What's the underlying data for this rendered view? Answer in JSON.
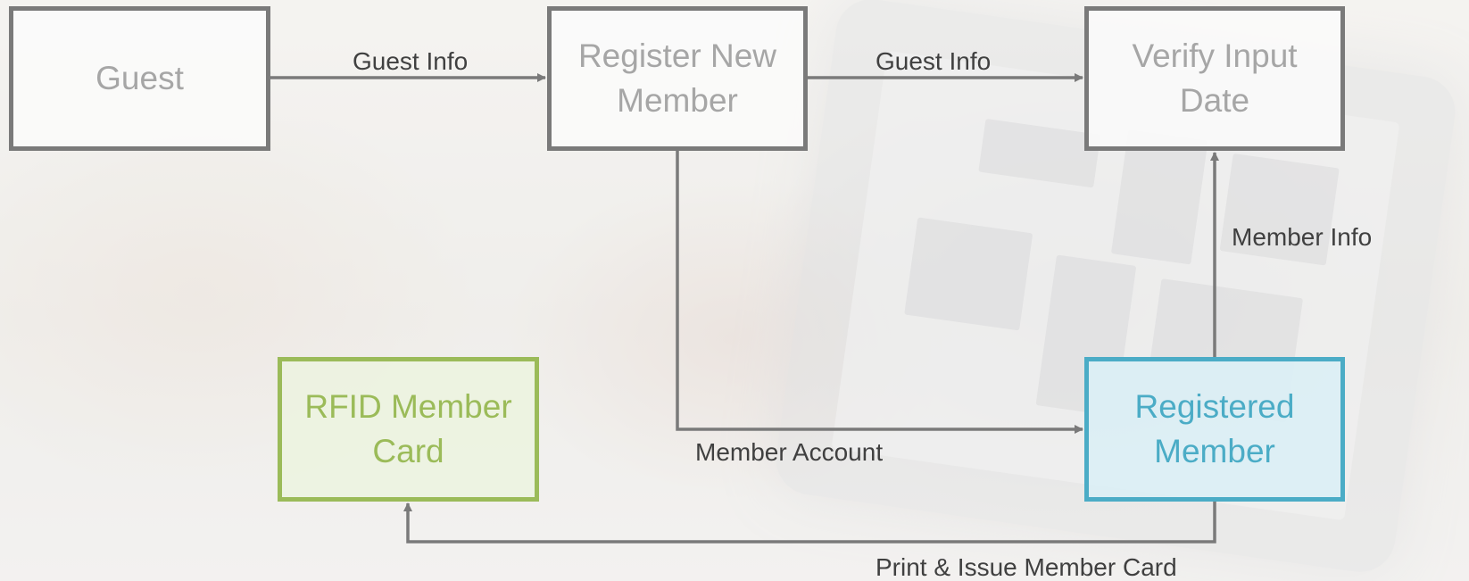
{
  "nodes": {
    "guest": {
      "lines": [
        "Guest"
      ]
    },
    "register_new_member": {
      "lines": [
        "Register New",
        "Member"
      ]
    },
    "verify_input_date": {
      "lines": [
        "Verify Input",
        "Date"
      ]
    },
    "rfid_member_card": {
      "lines": [
        "RFID Member",
        "Card"
      ],
      "color": "#9bbb59"
    },
    "registered_member": {
      "lines": [
        "Registered",
        "Member"
      ],
      "color": "#4bacc6"
    }
  },
  "edges": {
    "guest_to_register": {
      "label": "Guest Info"
    },
    "register_to_verify": {
      "label": "Guest Info"
    },
    "registered_to_verify": {
      "label": "Member Info"
    },
    "register_to_registered": {
      "label": "Member Account"
    },
    "registered_to_rfid": {
      "label": "Print & Issue Member Card"
    }
  },
  "colors": {
    "box_border": "#7a7a7a",
    "connector": "#7a7a7a",
    "label_text": "#404040",
    "box_text": "#a6a6a6"
  }
}
